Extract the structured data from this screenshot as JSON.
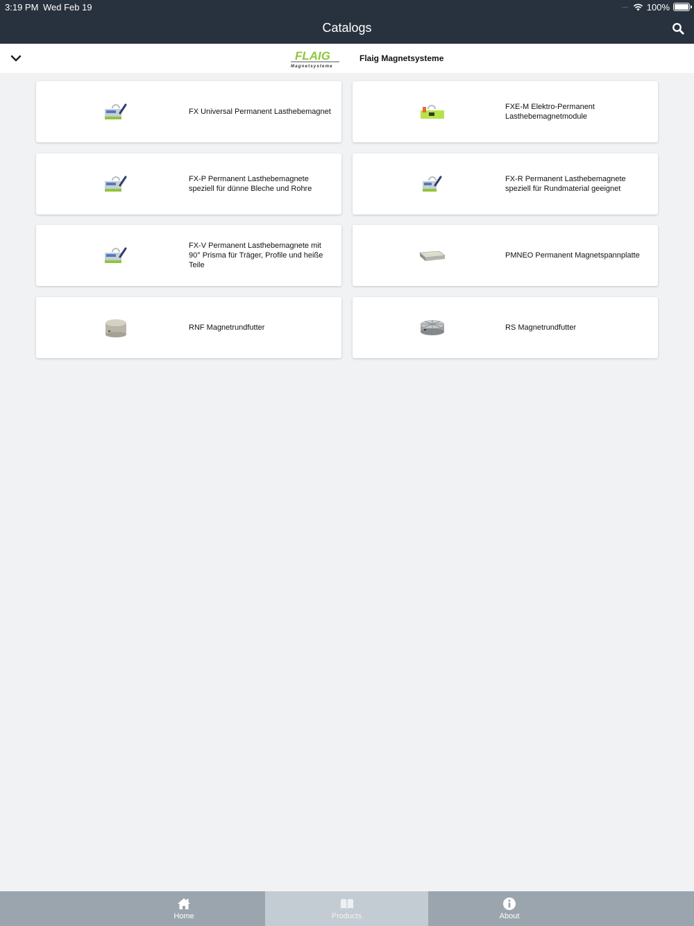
{
  "status": {
    "time": "3:19 PM",
    "date": "Wed Feb 19",
    "signal": "····",
    "battery": "100%"
  },
  "header": {
    "title": "Catalogs",
    "search_icon": "search-icon"
  },
  "brand": {
    "collapse_icon": "chevron-down-icon",
    "logo_text": "FLAIG",
    "logo_subtext": "Magnetsysteme",
    "name": "Flaig Magnetsysteme"
  },
  "catalogs": [
    {
      "label": "FX Universal Permanent Lasthebemagnet",
      "image": "lifting-magnet-image"
    },
    {
      "label": "FXE-M Elektro-Permanent Lasthebemagnetmodule",
      "image": "electro-lifting-magnet-image"
    },
    {
      "label": "FX-P Permanent Lasthebemagnete speziell für dünne Bleche und Rohre",
      "image": "lifting-magnet-image"
    },
    {
      "label": "FX-R Permanent Lasthebemagnete speziell für Rundmaterial geeignet",
      "image": "lifting-magnet-image"
    },
    {
      "label": "FX-V Permanent Lasthebemagnete mit 90° Prisma für Träger, Profile und heiße Teile",
      "image": "lifting-magnet-image"
    },
    {
      "label": "PMNEO Permanent Magnetspannplatte",
      "image": "clamping-plate-image"
    },
    {
      "label": "RNF Magnetrundfutter",
      "image": "round-chuck-image"
    },
    {
      "label": "RS Magnetrundfutter",
      "image": "radial-chuck-image"
    }
  ],
  "tabs": [
    {
      "label": "Home",
      "icon": "home-icon"
    },
    {
      "label": "Products",
      "icon": "book-icon",
      "active": true
    },
    {
      "label": "About",
      "icon": "info-icon"
    }
  ],
  "colors": {
    "header_bg": "#28323e",
    "page_bg": "#f0f2f4",
    "tabbar_bg": "#9aa5ae",
    "tab_active_bg": "#c3ccd3",
    "brand_green": "#8dc63f"
  }
}
